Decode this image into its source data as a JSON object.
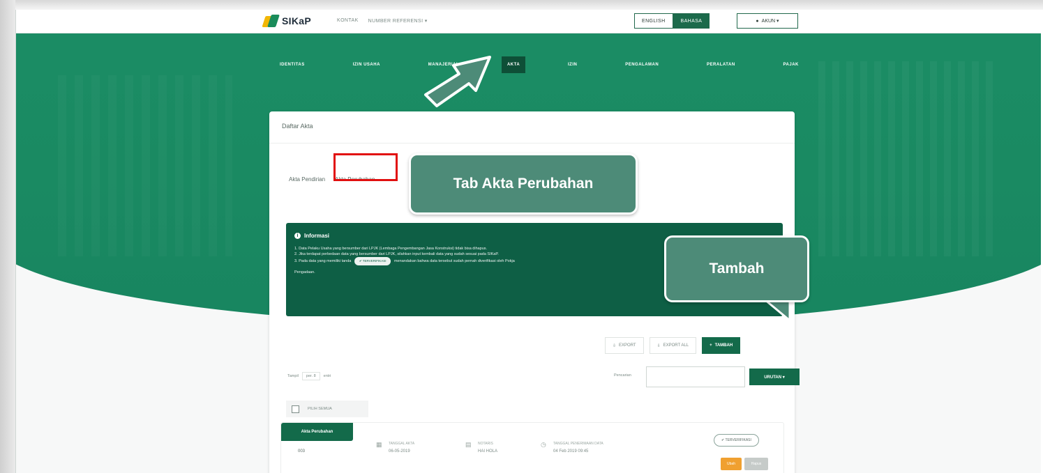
{
  "app": {
    "logo_text": "SIKaP",
    "top_nav": [
      "KONTAK",
      "NUMBER REFERENSI ▾"
    ],
    "lang_en": "ENGLISH",
    "lang_id": "BAHASA",
    "account": "AKUN ▾"
  },
  "menu": {
    "items": [
      "IDENTITAS",
      "IZIN USAHA",
      "MANAJERIAL",
      "AKTA",
      "IZIN",
      "PENGALAMAN",
      "PERALATAN",
      "PAJAK"
    ],
    "active": "AKTA"
  },
  "card": {
    "title": "Daftar Akta",
    "tabs": [
      "Akta Pendirian",
      "Akta Perubahan"
    ]
  },
  "info": {
    "title": "Informasi",
    "line1": "1. Data Pelaku Usaha yang bersumber dari LPJK (Lembaga Pengembangan Jasa Konstruksi) tidak bisa dihapus.",
    "line2": "2. Jika terdapat perbedaan data yang bersumber dari LPJK, silahkan input kembali data yang sudah sesuai pada SIKaP.",
    "line3_a": "3. Pada data yang memiliki tanda",
    "line3_pill": "✔ TERVERIFIKASI",
    "line3_b": "menandakan bahwa data tersebut sudah pernah diverifikasi oleh Pokja",
    "line4": "Pengadaan."
  },
  "actions": {
    "export": "EXPORT",
    "export_all": "EXPORT ALL",
    "tambah": "TAMBAH"
  },
  "table": {
    "show_label": "Tampil",
    "show_value": "per. 8",
    "show_suffix": "entri",
    "search_label": "Pencarian",
    "sort_button": "URUTAN ▾",
    "select_all": "PILIH SEMUA"
  },
  "row": {
    "tag": "Akta Perubahan",
    "number": "003",
    "tanggal_label": "TANGGAL AKTA",
    "tanggal_value": "06-05-2019",
    "notaris_label": "NOTARIS",
    "notaris_value": "HAI HOLA",
    "terima_label": "TANGGAL PENERIMAAN DATA",
    "terima_value": "04 Feb 2019 09:45",
    "verified": "✔ TERVERIFIKASI",
    "ubah": "Ubah",
    "hapus": "Hapus"
  },
  "callouts": {
    "tab": "Tab Akta Perubahan",
    "tambah": "Tambah"
  },
  "colors": {
    "brand_green": "#1a8a62",
    "dark_green": "#0e5f45",
    "highlight_red": "#e10f0f",
    "callout": "#4d8b78"
  }
}
